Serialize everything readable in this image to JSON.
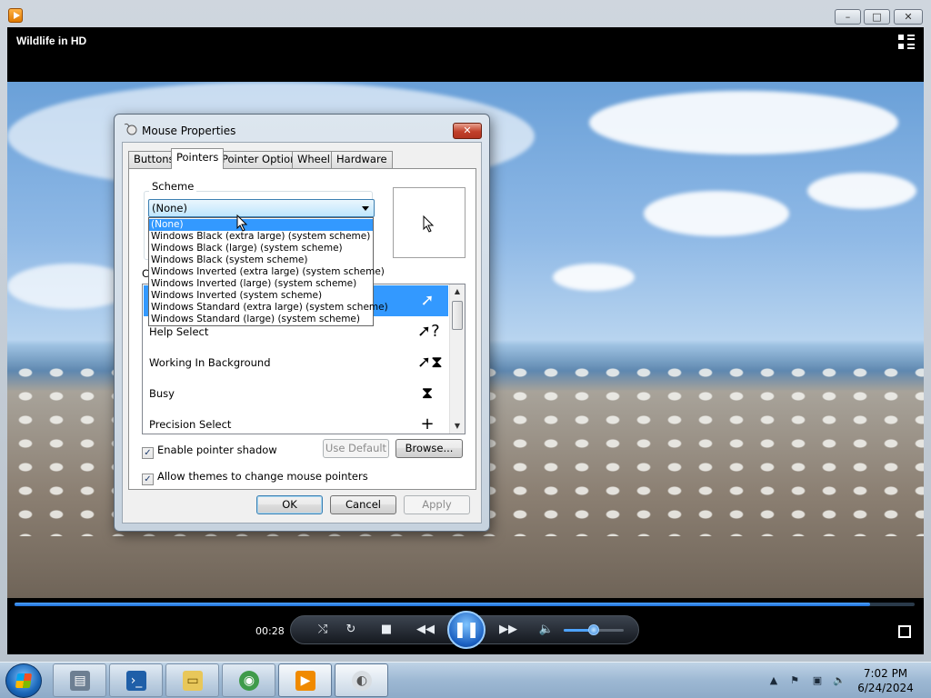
{
  "player": {
    "title": "Wildlife in HD",
    "time_elapsed": "00:28",
    "progress_fraction": 0.95,
    "volume_fraction": 0.5,
    "window_buttons": {
      "minimize": "–",
      "maximize": "□",
      "close": "✕"
    },
    "controls": {
      "shuffle": "⤭",
      "repeat": "↻",
      "stop": "■",
      "prev": "◀◀",
      "play_pause": "❚❚",
      "next": "▶▶",
      "mute": "🔈"
    },
    "accent_color": "#1f6fd6"
  },
  "dialog": {
    "title": "Mouse Properties",
    "close_glyph": "✕",
    "tabs": [
      {
        "label": "Buttons"
      },
      {
        "label": "Pointers"
      },
      {
        "label": "Pointer Options"
      },
      {
        "label": "Wheel"
      },
      {
        "label": "Hardware"
      }
    ],
    "active_tab": "Pointers",
    "scheme_label": "Scheme",
    "scheme_value": "(None)",
    "customize_label": "Cu",
    "scheme_options": [
      "(None)",
      "Windows Black (extra large) (system scheme)",
      "Windows Black (large) (system scheme)",
      "Windows Black (system scheme)",
      "Windows Inverted (extra large) (system scheme)",
      "Windows Inverted (large) (system scheme)",
      "Windows Inverted (system scheme)",
      "Windows Standard (extra large) (system scheme)",
      "Windows Standard (large) (system scheme)"
    ],
    "pointer_list": [
      {
        "label": "",
        "cursor": "➚"
      },
      {
        "label": "Help Select",
        "cursor": "➚?"
      },
      {
        "label": "Working In Background",
        "cursor": "➚⧗"
      },
      {
        "label": "Busy",
        "cursor": "⧗"
      },
      {
        "label": "Precision Select",
        "cursor": "+"
      }
    ],
    "enable_shadow_label": "Enable pointer shadow",
    "enable_shadow_checked": true,
    "allow_themes_label": "Allow themes to change mouse pointers",
    "allow_themes_checked": true,
    "use_default_label": "Use Default",
    "browse_label": "Browse...",
    "ok_label": "OK",
    "cancel_label": "Cancel",
    "apply_label": "Apply",
    "check_glyph": "✓"
  },
  "taskbar": {
    "time": "7:02 PM",
    "date": "6/24/2024",
    "items": [
      {
        "name": "server-manager",
        "glyph": "▤"
      },
      {
        "name": "powershell",
        "glyph": "›_"
      },
      {
        "name": "explorer",
        "glyph": "▭"
      },
      {
        "name": "browser",
        "glyph": "◉"
      },
      {
        "name": "media-player",
        "glyph": "▶"
      },
      {
        "name": "mouse-properties",
        "glyph": "◐"
      }
    ],
    "tray": {
      "show_hidden": "▲",
      "flag": "⚑",
      "network": "▣",
      "volume": "🔈"
    }
  }
}
